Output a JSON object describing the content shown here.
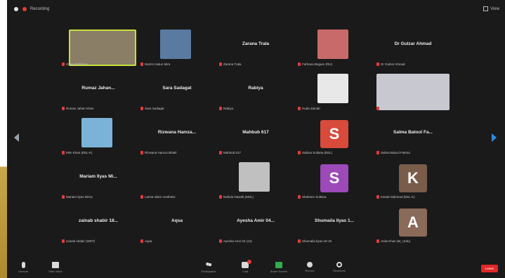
{
  "colors": {
    "background": "#1a1a1a",
    "mute_red": "#e03b3b",
    "active_speaker": "#c5e03a",
    "share_green": "#2fae4e",
    "end_red": "#e02828",
    "next_page_arrow": "#2b8de3"
  },
  "topbar": {
    "recording_label": "Recording",
    "view_label": "View"
  },
  "participants": [
    {
      "name": "",
      "footer": "Gloria Rahman",
      "kind": "video",
      "active": true,
      "photo": "#8a7e66"
    },
    {
      "name": "",
      "footer": "Nazrin Hatun Mira",
      "kind": "photo",
      "photo": "#5a7aa0"
    },
    {
      "name": "Zarana Trala",
      "footer": "Zarana Trala",
      "kind": "name"
    },
    {
      "name": "",
      "footer": "Farhana Begum (RU)",
      "kind": "photo",
      "photo": "#c86a6a"
    },
    {
      "name": "Dr Gulzar Ahmad",
      "footer": "Dr Gulzar Ahmad",
      "kind": "name"
    },
    {
      "name": "Rumaz Jahan...",
      "footer": "Rumaz Jahan Khan",
      "kind": "name"
    },
    {
      "name": "Sara Sadagat",
      "footer": "Sara Sadagat",
      "kind": "name"
    },
    {
      "name": "Rabiya",
      "footer": "Rabiya",
      "kind": "name"
    },
    {
      "name": "",
      "footer": "Huda Zainab",
      "kind": "photo",
      "photo": "#e8e8e8"
    },
    {
      "name": "",
      "footer": "Arun Kumar (IIT-MBA)",
      "kind": "video-wide",
      "photo": "#c8c8d0"
    },
    {
      "name": "",
      "footer": "Mim Khan (EEL-K)",
      "kind": "photo",
      "photo": "#7bb3d8"
    },
    {
      "name": "Rizwana Hamza...",
      "footer": "Rizwana Hamza Bhatti",
      "kind": "name"
    },
    {
      "name": "Mahbub 617",
      "footer": "Mahbub 617",
      "kind": "name"
    },
    {
      "name": "",
      "footer": "Sabina Sultana (EEL)",
      "kind": "avatar",
      "letter": "S",
      "color": "#d84a3a"
    },
    {
      "name": "Salma Batool Fa...",
      "footer": "Salma Batool Fatima",
      "kind": "name"
    },
    {
      "name": "Mariam Ilyas Mi...",
      "footer": "Mariam Ilyas Mirza",
      "kind": "name"
    },
    {
      "name": "",
      "footer": "Lamia Islam Aesthetic",
      "kind": "empty"
    },
    {
      "name": "",
      "footer": "Nahida Nawab (MSL)",
      "kind": "photo",
      "photo": "#c0c0c0"
    },
    {
      "name": "",
      "footer": "Shaheen Sultana",
      "kind": "avatar",
      "letter": "S",
      "color": "#9c4ab8"
    },
    {
      "name": "",
      "footer": "Kanak Mahmud (EEL-K)",
      "kind": "avatar",
      "letter": "K",
      "color": "#7a5c4a"
    },
    {
      "name": "zainab shabir 18...",
      "footer": "zainab shabir (WDT)",
      "kind": "name"
    },
    {
      "name": "Aqsa",
      "footer": "Aqsa",
      "kind": "name"
    },
    {
      "name": "Ayesha Amir 04...",
      "footer": "Ayesha Amir 04 (13)",
      "kind": "name"
    },
    {
      "name": "Shumaila Ilyas 1...",
      "footer": "Shumaila Ilyas 18-19",
      "kind": "name"
    },
    {
      "name": "",
      "footer": "Anila Khan (M_Urdu)",
      "kind": "avatar",
      "letter": "A",
      "color": "#8a6a58"
    }
  ],
  "toolbar": {
    "mute": "Unmute",
    "video": "Start Video",
    "participants": "Participants",
    "participants_count": "43",
    "chat": "Chat",
    "share": "Share Screen",
    "record": "Record",
    "reactions": "Reactions",
    "end": "Leave"
  }
}
